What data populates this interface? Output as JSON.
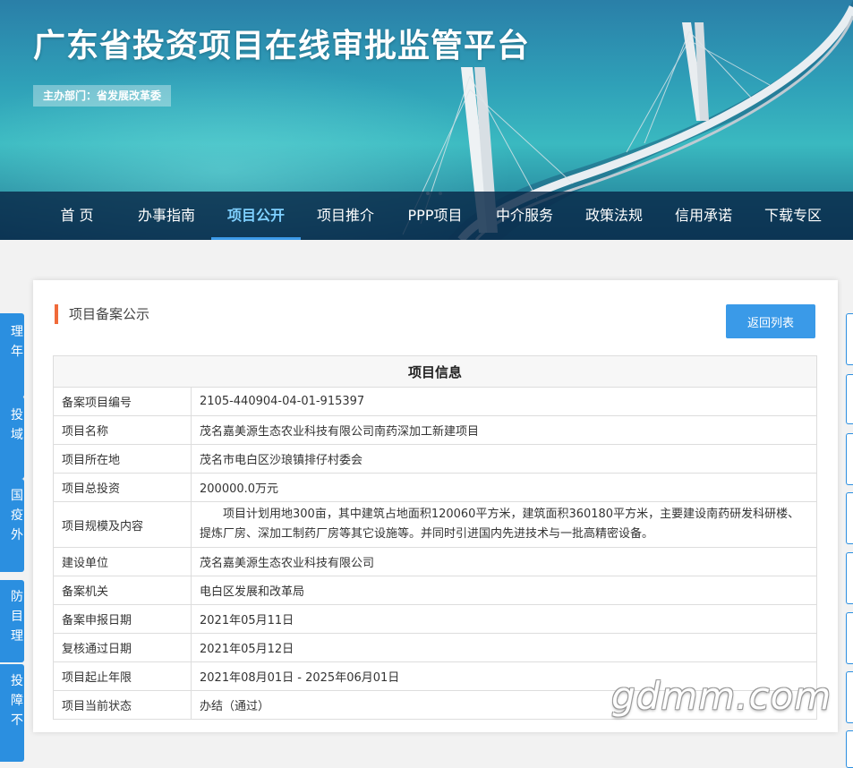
{
  "header": {
    "site_title": "广东省投资项目在线审批监管平台",
    "sponsor": "主办部门：省发展改革委"
  },
  "nav": {
    "items": [
      "首 页",
      "办事指南",
      "项目公开",
      "项目推介",
      "PPP项目",
      "中介服务",
      "政策法规",
      "信用承诺",
      "下载专区"
    ],
    "active": "项目公开"
  },
  "side_left": [
    [
      "理",
      "年"
    ],
    [
      "投",
      "域"
    ],
    [
      "国",
      "疫",
      "外"
    ],
    [
      "防",
      "目",
      "理"
    ],
    [
      "投",
      "障",
      "不"
    ]
  ],
  "panel": {
    "title": "项目备案公示",
    "back_button": "返回列表"
  },
  "table": {
    "heading": "项目信息",
    "rows": [
      {
        "label": "备案项目编号",
        "value": "2105-440904-04-01-915397"
      },
      {
        "label": "项目名称",
        "value": "茂名嘉美源生态农业科技有限公司南药深加工新建项目"
      },
      {
        "label": "项目所在地",
        "value": "茂名市电白区沙琅镇排仔村委会"
      },
      {
        "label": "项目总投资",
        "value": "200000.0万元"
      },
      {
        "label": "项目规模及内容",
        "value": "项目计划用地300亩，其中建筑占地面积120060平方米，建筑面积360180平方米，主要建设南药研发科研楼、提炼厂房、深加工制药厂房等其它设施等。并同时引进国内先进技术与一批高精密设备。"
      },
      {
        "label": "建设单位",
        "value": "茂名嘉美源生态农业科技有限公司"
      },
      {
        "label": "备案机关",
        "value": "电白区发展和改革局"
      },
      {
        "label": "备案申报日期",
        "value": "2021年05月11日"
      },
      {
        "label": "复核通过日期",
        "value": "2021年05月12日"
      },
      {
        "label": "项目起止年限",
        "value": "2021年08月01日 - 2025年06月01日"
      },
      {
        "label": "项目当前状态",
        "value": "办结（通过）"
      }
    ]
  },
  "watermark": "gdmm.com",
  "colors": {
    "accent": "#3a9ae8",
    "title_marker": "#f06a3a",
    "nav_bg": "#08284b",
    "side_tab": "#2b8fe0"
  }
}
